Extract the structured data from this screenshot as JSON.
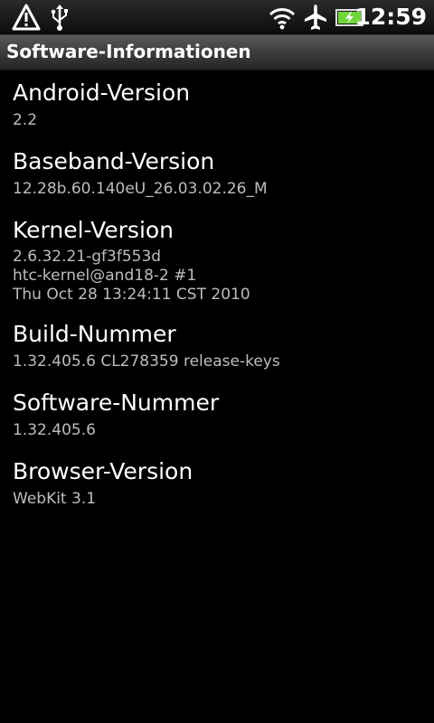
{
  "status_bar": {
    "time": "12:59",
    "icons": [
      "warning-icon",
      "usb-icon",
      "wifi-icon",
      "airplane-mode-icon",
      "battery-charging-icon"
    ],
    "battery_color": "#6fd63a"
  },
  "title_bar": {
    "title": "Software-Informationen"
  },
  "items": [
    {
      "title": "Android-Version",
      "values": [
        "2.2"
      ]
    },
    {
      "title": "Baseband-Version",
      "values": [
        "12.28b.60.140eU_26.03.02.26_M"
      ]
    },
    {
      "title": "Kernel-Version",
      "values": [
        "2.6.32.21-gf3f553d",
        "htc-kernel@and18-2 #1",
        "Thu Oct 28 13:24:11 CST 2010"
      ]
    },
    {
      "title": "Build-Nummer",
      "values": [
        "1.32.405.6 CL278359 release-keys"
      ]
    },
    {
      "title": "Software-Nummer",
      "values": [
        "1.32.405.6"
      ]
    },
    {
      "title": "Browser-Version",
      "values": [
        "WebKit 3.1"
      ]
    }
  ]
}
